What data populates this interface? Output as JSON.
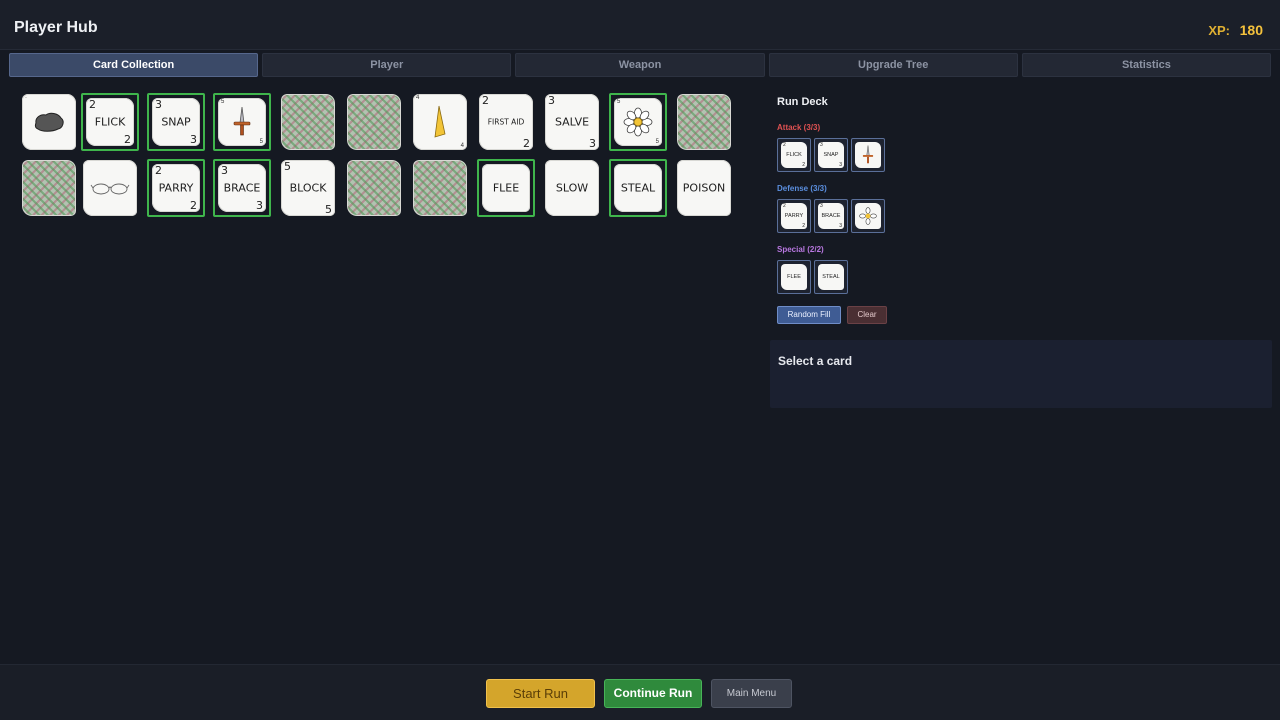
{
  "header": {
    "title": "Player Hub",
    "xp_label": "XP:",
    "xp_value": "180"
  },
  "tabs": [
    {
      "label": "Card Collection",
      "active": true
    },
    {
      "label": "Player",
      "active": false
    },
    {
      "label": "Weapon",
      "active": false
    },
    {
      "label": "Upgrade Tree",
      "active": false
    },
    {
      "label": "Statistics",
      "active": false
    }
  ],
  "collection": {
    "row1": [
      {
        "label": "",
        "icon": "rock-icon",
        "state": "unlocked"
      },
      {
        "label": "FLICK",
        "cost_tl": "2",
        "cost_br": "2",
        "state": "selected"
      },
      {
        "label": "SNAP",
        "cost_tl": "3",
        "cost_br": "3",
        "state": "selected"
      },
      {
        "label": "",
        "icon": "dagger-icon",
        "state": "selected"
      },
      {
        "label": "",
        "icon": "locked-card-icon",
        "state": "locked"
      },
      {
        "label": "",
        "icon": "locked-card-icon",
        "state": "locked"
      },
      {
        "label": "",
        "icon": "blade-icon",
        "state": "unlocked"
      },
      {
        "label": "FIRST AID",
        "cost_tl": "2",
        "cost_br": "2",
        "state": "unlocked"
      },
      {
        "label": "SALVE",
        "cost_tl": "3",
        "cost_br": "3",
        "state": "unlocked"
      },
      {
        "label": "",
        "icon": "flower-icon",
        "state": "selected"
      },
      {
        "label": "",
        "icon": "locked-card-icon",
        "state": "locked"
      }
    ],
    "row2": [
      {
        "label": "",
        "icon": "locked-card-icon",
        "state": "locked"
      },
      {
        "label": "",
        "icon": "glasses-icon",
        "state": "unlocked"
      },
      {
        "label": "PARRY",
        "cost_tl": "2",
        "cost_br": "2",
        "state": "selected"
      },
      {
        "label": "BRACE",
        "cost_tl": "3",
        "cost_br": "3",
        "state": "selected"
      },
      {
        "label": "BLOCK",
        "cost_tl": "5",
        "cost_br": "5",
        "state": "unlocked"
      },
      {
        "label": "",
        "icon": "locked-card-icon",
        "state": "locked"
      },
      {
        "label": "",
        "icon": "locked-card-icon",
        "state": "locked"
      },
      {
        "label": "FLEE",
        "state": "selected"
      },
      {
        "label": "SLOW",
        "state": "unlocked"
      },
      {
        "label": "STEAL",
        "state": "selected"
      },
      {
        "label": "POISON",
        "state": "unlocked"
      }
    ]
  },
  "run_deck": {
    "title": "Run Deck",
    "attack": {
      "label": "Attack (3/3)",
      "color": "#e05252",
      "cards": [
        "FLICK",
        "SNAP",
        ""
      ]
    },
    "defense": {
      "label": "Defense (3/3)",
      "color": "#5b8fe0",
      "cards": [
        "PARRY",
        "BRACE",
        ""
      ]
    },
    "special": {
      "label": "Special (2/2)",
      "color": "#b877e0",
      "cards": [
        "FLEE",
        "STEAL"
      ]
    },
    "random_fill": "Random Fill",
    "clear": "Clear"
  },
  "detail": {
    "text": "Select a card"
  },
  "footer": {
    "start_run": "Start Run",
    "continue_run": "Continue Run",
    "main_menu": "Main Menu"
  },
  "colors": {
    "accent_selected": "#3fb54c",
    "xp": "#f5c23c",
    "start": "#d4a52b",
    "continue": "#2f8a3c"
  }
}
